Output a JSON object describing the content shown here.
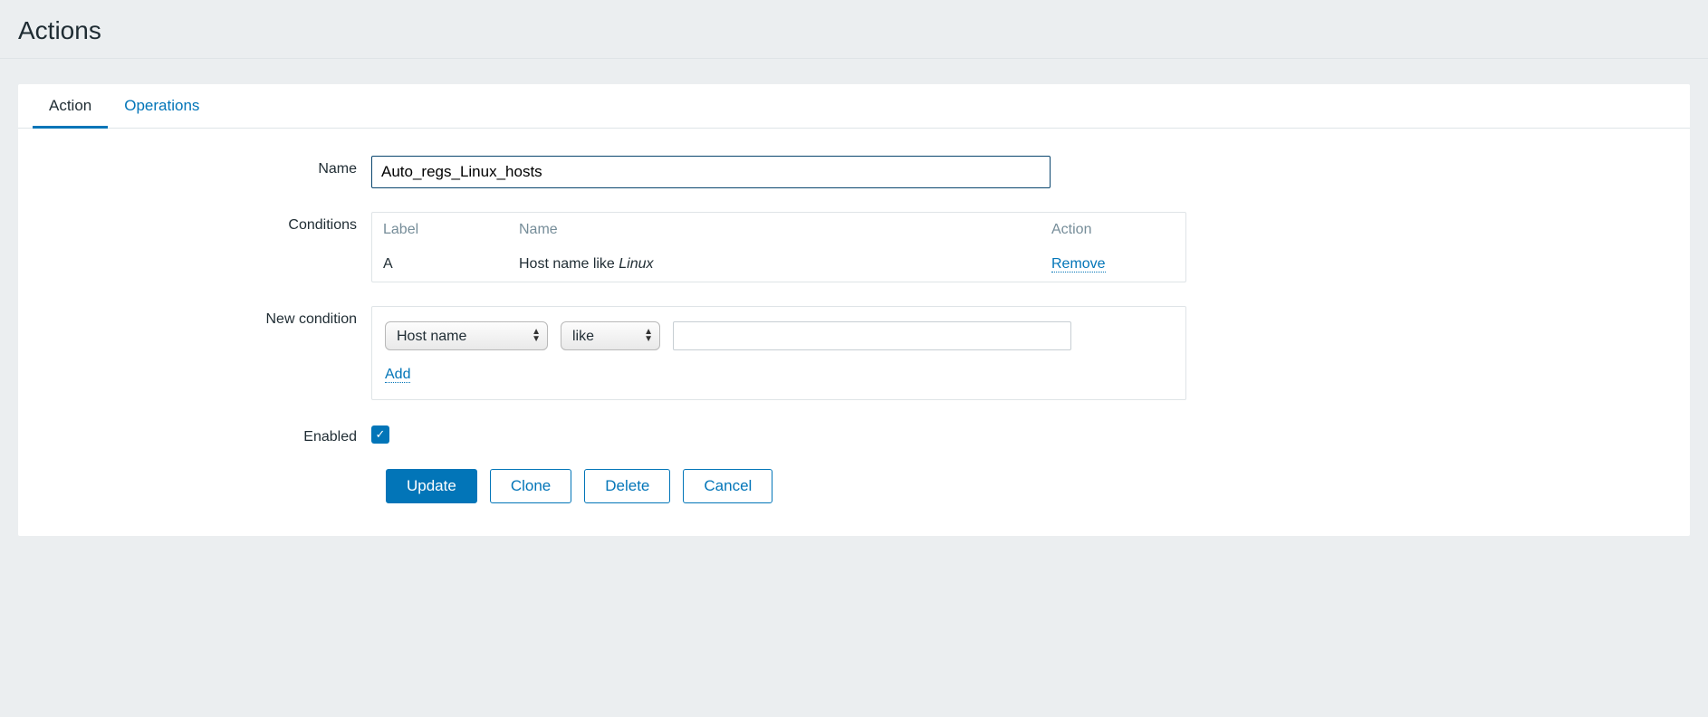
{
  "page_title": "Actions",
  "tabs": {
    "action": "Action",
    "operations": "Operations"
  },
  "form": {
    "name_label": "Name",
    "name_value": "Auto_regs_Linux_hosts",
    "conditions_label": "Conditions",
    "conditions_headers": {
      "label": "Label",
      "name": "Name",
      "action": "Action"
    },
    "conditions_rows": [
      {
        "label": "A",
        "name_prefix": "Host name like ",
        "name_value": "Linux",
        "action": "Remove"
      }
    ],
    "new_condition_label": "New condition",
    "new_condition": {
      "type_selected": "Host name",
      "operator_selected": "like",
      "value": "",
      "add_label": "Add"
    },
    "enabled_label": "Enabled",
    "enabled_checked": true
  },
  "buttons": {
    "update": "Update",
    "clone": "Clone",
    "delete": "Delete",
    "cancel": "Cancel"
  }
}
